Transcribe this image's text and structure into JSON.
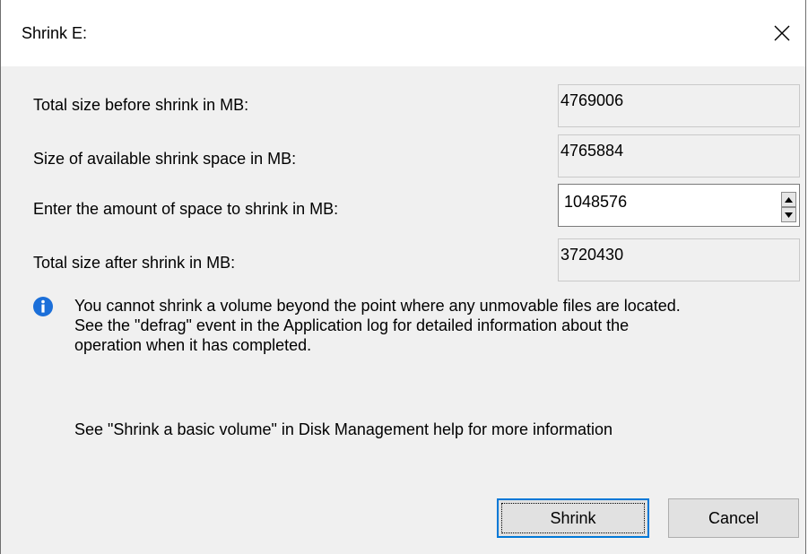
{
  "window": {
    "title": "Shrink E:",
    "close_icon": "close-icon"
  },
  "fields": {
    "total_before": {
      "label": "Total size before shrink in MB:",
      "value": "4769006"
    },
    "available": {
      "label": "Size of available shrink space in MB:",
      "value": "4765884"
    },
    "amount": {
      "label": "Enter the amount of space to shrink in MB:",
      "value": "1048576",
      "spin_up_icon": "spin-up-icon",
      "spin_down_icon": "spin-down-icon"
    },
    "total_after": {
      "label": "Total size after shrink in MB:",
      "value": "3720430"
    }
  },
  "info": {
    "icon": "info-icon",
    "line1": "You cannot shrink a volume beyond the point where any unmovable files are located.",
    "line2": "See the \"defrag\" event in the Application log for detailed information about the",
    "line3": "operation when it has completed."
  },
  "help": {
    "text": "See \"Shrink a basic volume\" in Disk Management help for more information"
  },
  "buttons": {
    "shrink": "Shrink",
    "cancel": "Cancel"
  },
  "colors": {
    "dialog_bg": "#f0f0f0",
    "titlebar_bg": "#ffffff",
    "info_icon": "#1b6fd9",
    "default_button_border": "#0078d7"
  }
}
